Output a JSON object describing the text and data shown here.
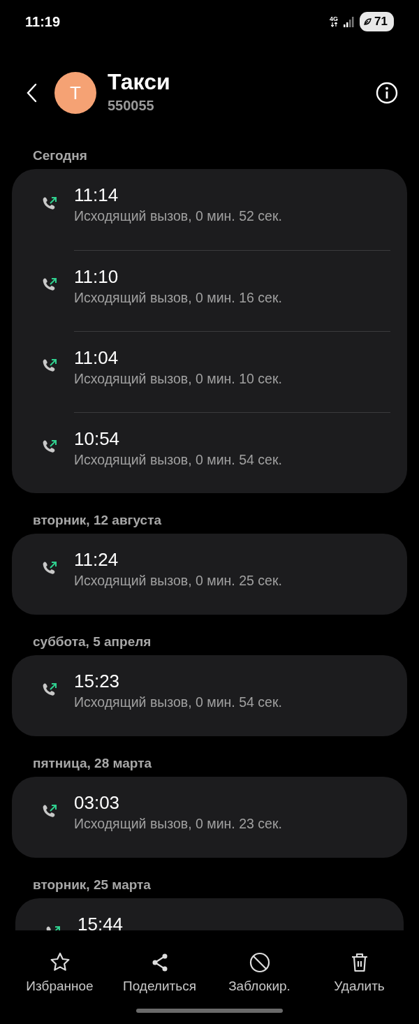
{
  "status_bar": {
    "time": "11:19",
    "network": "4G",
    "battery": "71"
  },
  "contact": {
    "initial": "Т",
    "name": "Такси",
    "number": "550055"
  },
  "sections": [
    {
      "date": "Сегодня",
      "calls": [
        {
          "kind": "outgoing",
          "time": "11:14",
          "description": "Исходящий вызов, 0 мин. 52 сек."
        },
        {
          "kind": "outgoing",
          "time": "11:10",
          "description": "Исходящий вызов, 0 мин. 16 сек."
        },
        {
          "kind": "outgoing",
          "time": "11:04",
          "description": "Исходящий вызов, 0 мин. 10 сек."
        },
        {
          "kind": "outgoing",
          "time": "10:54",
          "description": "Исходящий вызов, 0 мин. 54 сек."
        }
      ]
    },
    {
      "date": "вторник, 12 августа",
      "calls": [
        {
          "kind": "outgoing",
          "time": "11:24",
          "description": "Исходящий вызов, 0 мин. 25 сек."
        }
      ]
    },
    {
      "date": "суббота, 5 апреля",
      "calls": [
        {
          "kind": "outgoing",
          "time": "15:23",
          "description": "Исходящий вызов, 0 мин. 54 сек."
        }
      ]
    },
    {
      "date": "пятница, 28 марта",
      "calls": [
        {
          "kind": "outgoing",
          "time": "03:03",
          "description": "Исходящий вызов, 0 мин. 23 сек."
        }
      ]
    },
    {
      "date": "вторник, 25 марта",
      "calls": [
        {
          "kind": "outgoing",
          "time": "15:44"
        }
      ]
    }
  ],
  "bottom_actions": [
    {
      "kind": "favorite",
      "label": "Избранное"
    },
    {
      "kind": "share",
      "label": "Поделиться"
    },
    {
      "kind": "block",
      "label": "Заблокир."
    },
    {
      "kind": "delete",
      "label": "Удалить"
    }
  ]
}
